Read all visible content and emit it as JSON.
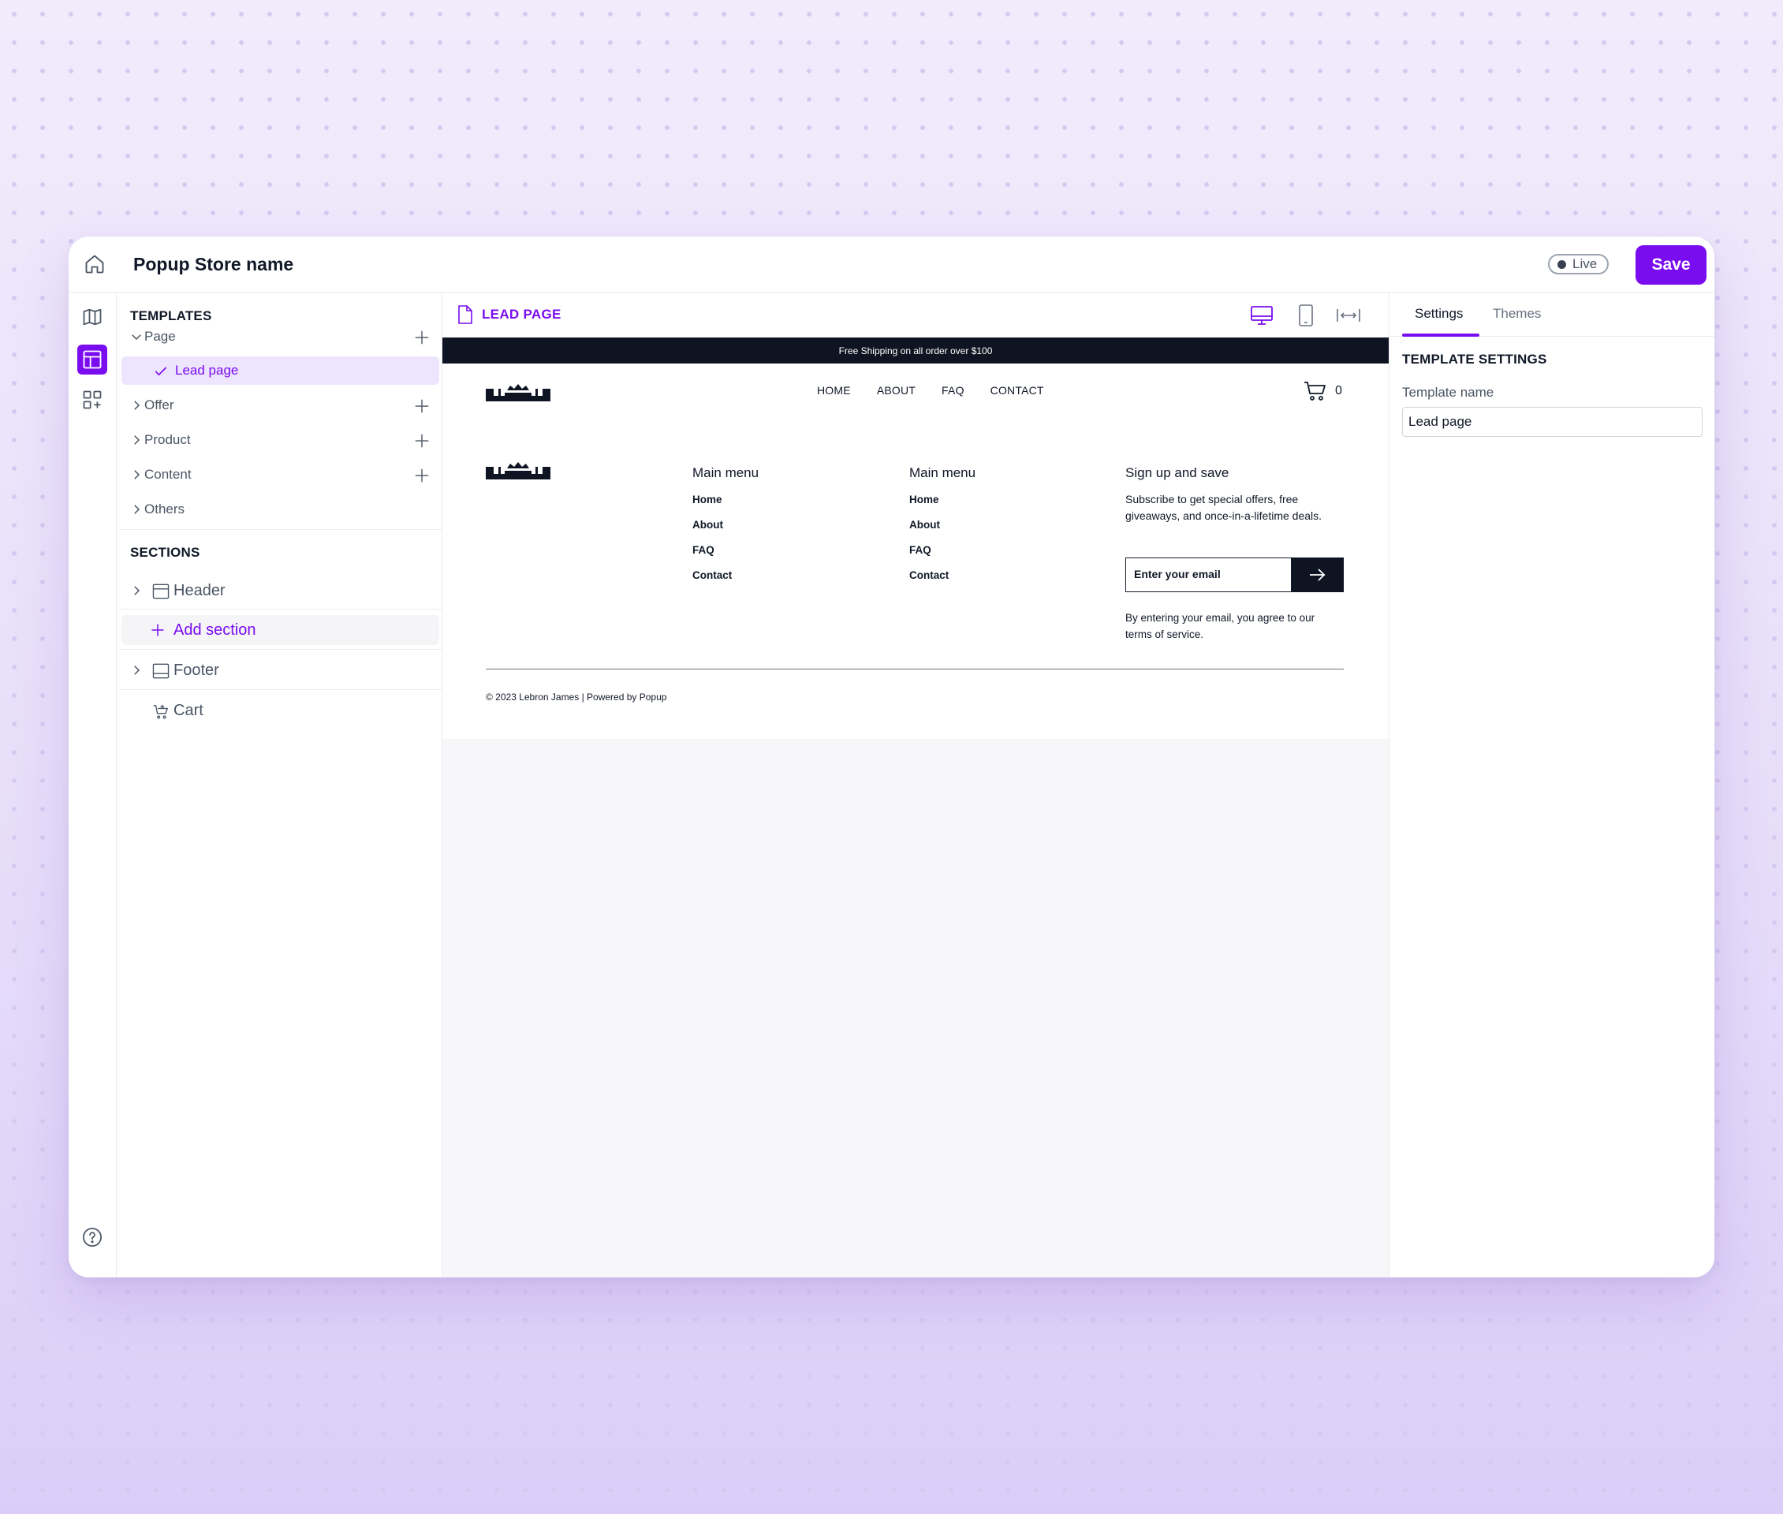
{
  "app": {
    "title": "Popup Store name",
    "status": "Live",
    "save_label": "Save",
    "accent_color": "#7a0cf0"
  },
  "left_rail": {
    "icons": [
      "home-icon",
      "map-icon",
      "layout-icon",
      "apps-add-icon",
      "help-icon"
    ]
  },
  "templates": {
    "heading": "TEMPLATES",
    "items": [
      {
        "label": "Page",
        "expanded": true
      },
      {
        "label": "Lead page",
        "selected": true
      },
      {
        "label": "Offer"
      },
      {
        "label": "Product"
      },
      {
        "label": "Content"
      },
      {
        "label": "Others"
      }
    ]
  },
  "sections": {
    "heading": "SECTIONS",
    "items": [
      {
        "label": "Header"
      },
      {
        "label": "Add section"
      },
      {
        "label": "Footer"
      },
      {
        "label": "Cart"
      }
    ]
  },
  "canvas": {
    "title": "LEAD PAGE",
    "devices": [
      "desktop-icon",
      "mobile-icon",
      "fit-width-icon"
    ]
  },
  "preview": {
    "announcement": "Free Shipping on all order over $100",
    "nav": [
      "HOME",
      "ABOUT",
      "FAQ",
      "CONTACT"
    ],
    "cart_count": "0",
    "footer": {
      "col1": {
        "heading": "Main menu",
        "links": [
          "Home",
          "About",
          "FAQ",
          "Contact"
        ]
      },
      "col2": {
        "heading": "Main menu",
        "links": [
          "Home",
          "About",
          "FAQ",
          "Contact"
        ]
      },
      "signup": {
        "heading": "Sign up and save",
        "text": "Subscribe to get special offers, free giveaways, and once-in-a-lifetime deals.",
        "placeholder": "Enter your email",
        "disclaimer": "By entering your email, you agree to our terms of service."
      },
      "copyright": "© 2023 Lebron James | Powered by Popup"
    }
  },
  "right_panel": {
    "tabs": [
      "Settings",
      "Themes"
    ],
    "heading": "TEMPLATE SETTINGS",
    "field_label": "Template name",
    "field_value": "Lead page"
  }
}
